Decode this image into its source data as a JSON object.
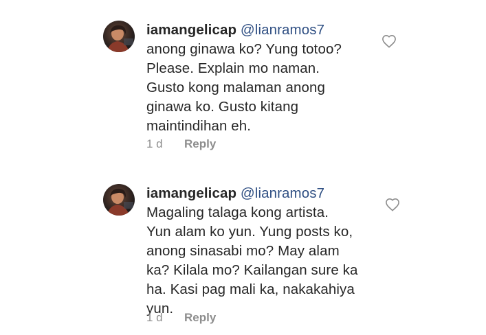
{
  "comments": [
    {
      "username": "iamangelicap",
      "mention": "@lianramos7",
      "lines": [
        "anong ginawa ko? Yung totoo?",
        "Please. Explain mo naman.",
        "Gusto kong malaman anong",
        "ginawa ko. Gusto kitang",
        "maintindihan eh."
      ],
      "time": "1 d",
      "reply_label": "Reply"
    },
    {
      "username": "iamangelicap",
      "mention": "@lianramos7",
      "lines": [
        "Magaling talaga kong artista.",
        "Yun alam ko yun. Yung posts ko,",
        "anong sinasabi mo? May alam",
        "ka? Kilala mo? Kailangan sure ka",
        "ha. Kasi pag mali ka, nakakahiya",
        "yun."
      ],
      "time": "1 d",
      "reply_label": "Reply"
    }
  ],
  "icons": {
    "like": "heart-outline-icon",
    "avatar": "profile-photo"
  },
  "colors": {
    "text": "#262626",
    "mention": "#2f4f83",
    "meta": "#8e8e8e"
  }
}
